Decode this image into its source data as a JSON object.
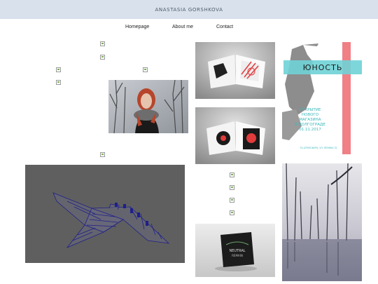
{
  "header": {
    "site_title": "ANASTASIA GORSHKOVA"
  },
  "nav": {
    "items": [
      {
        "label": "Homepage"
      },
      {
        "label": "About me"
      },
      {
        "label": "Contact"
      }
    ]
  },
  "gallery": {
    "poster_yunost": {
      "title": "ЮНОСТЬ",
      "line1": "ОТКРЫТИЕ",
      "line2": "НОВОГО",
      "line3": "МАГАЗИНА",
      "line4": "В ВОЛГОГРАДЕ",
      "date": "01.11.2017",
      "address": "ТЦ АТМОСФЕРА, УЛ. ЛЕНИНА 32",
      "accent_color": "#6fd3d6"
    },
    "album_cover": {
      "title": "NEUTRAL",
      "subtitle": "REMAIN"
    },
    "colors": {
      "wireframe_bg": "#5f5f5f",
      "wireframe_lines": "#1f1f8a",
      "accent_red": "#e23b3b"
    }
  }
}
